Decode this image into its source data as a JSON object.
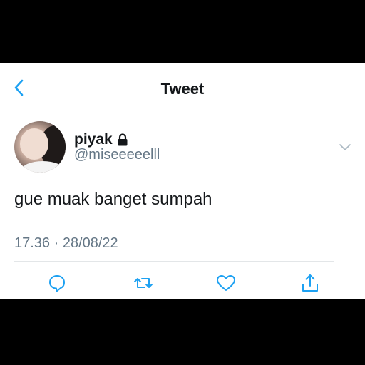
{
  "nav": {
    "title": "Tweet",
    "back_icon": "chevron-left-icon"
  },
  "tweet": {
    "name": "piyak",
    "handle": "@miseeeeelll",
    "text": "gue muak banget sumpah",
    "timestamp": "17.36 · 28/08/22"
  },
  "actions": [
    "reply-icon",
    "retweet-icon",
    "like-icon",
    "share-icon"
  ],
  "colors": {
    "accent": "#1da1f2",
    "secondary_text": "#657786",
    "icon": "#1da1f2"
  }
}
